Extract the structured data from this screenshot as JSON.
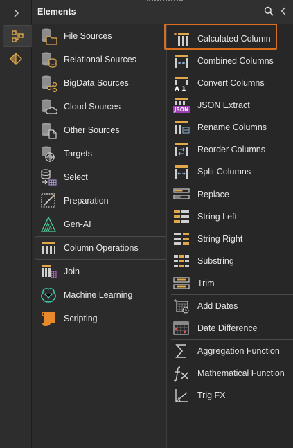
{
  "header": {
    "title": "Elements"
  },
  "categories": [
    {
      "label": "File Sources",
      "icon": "file-sources-icon"
    },
    {
      "label": "Relational Sources",
      "icon": "relational-sources-icon"
    },
    {
      "label": "BigData Sources",
      "icon": "bigdata-sources-icon"
    },
    {
      "label": "Cloud Sources",
      "icon": "cloud-sources-icon"
    },
    {
      "label": "Other Sources",
      "icon": "other-sources-icon"
    },
    {
      "label": "Targets",
      "icon": "targets-icon"
    },
    {
      "label": "Select",
      "icon": "select-icon"
    },
    {
      "label": "Preparation",
      "icon": "preparation-icon"
    },
    {
      "label": "Gen-AI",
      "icon": "gen-ai-icon"
    },
    {
      "label": "Column Operations",
      "icon": "column-operations-icon",
      "selected": true
    },
    {
      "label": "Join",
      "icon": "join-icon"
    },
    {
      "label": "Machine Learning",
      "icon": "machine-learning-icon"
    },
    {
      "label": "Scripting",
      "icon": "scripting-icon"
    }
  ],
  "items": {
    "calculated_column": "Calculated Column",
    "combined_columns": "Combined Columns",
    "convert_columns": "Convert Columns",
    "json_extract": "JSON Extract",
    "rename_columns": "Rename Columns",
    "reorder_columns": "Reorder Columns",
    "split_columns": "Split Columns",
    "replace": "Replace",
    "string_left": "String Left",
    "string_right": "String Right",
    "substring": "Substring",
    "trim": "Trim",
    "add_dates": "Add Dates",
    "date_difference": "Date Difference",
    "aggregation_function": "Aggregation Function",
    "mathematical_function": "Mathematical Function",
    "trig_fx": "Trig FX"
  },
  "icon_labels": {
    "json": "JSON",
    "a1": "A 1"
  },
  "colors": {
    "highlight": "#d96f1e",
    "accent": "#e0a84a",
    "json_badge": "#9b3fb5"
  }
}
